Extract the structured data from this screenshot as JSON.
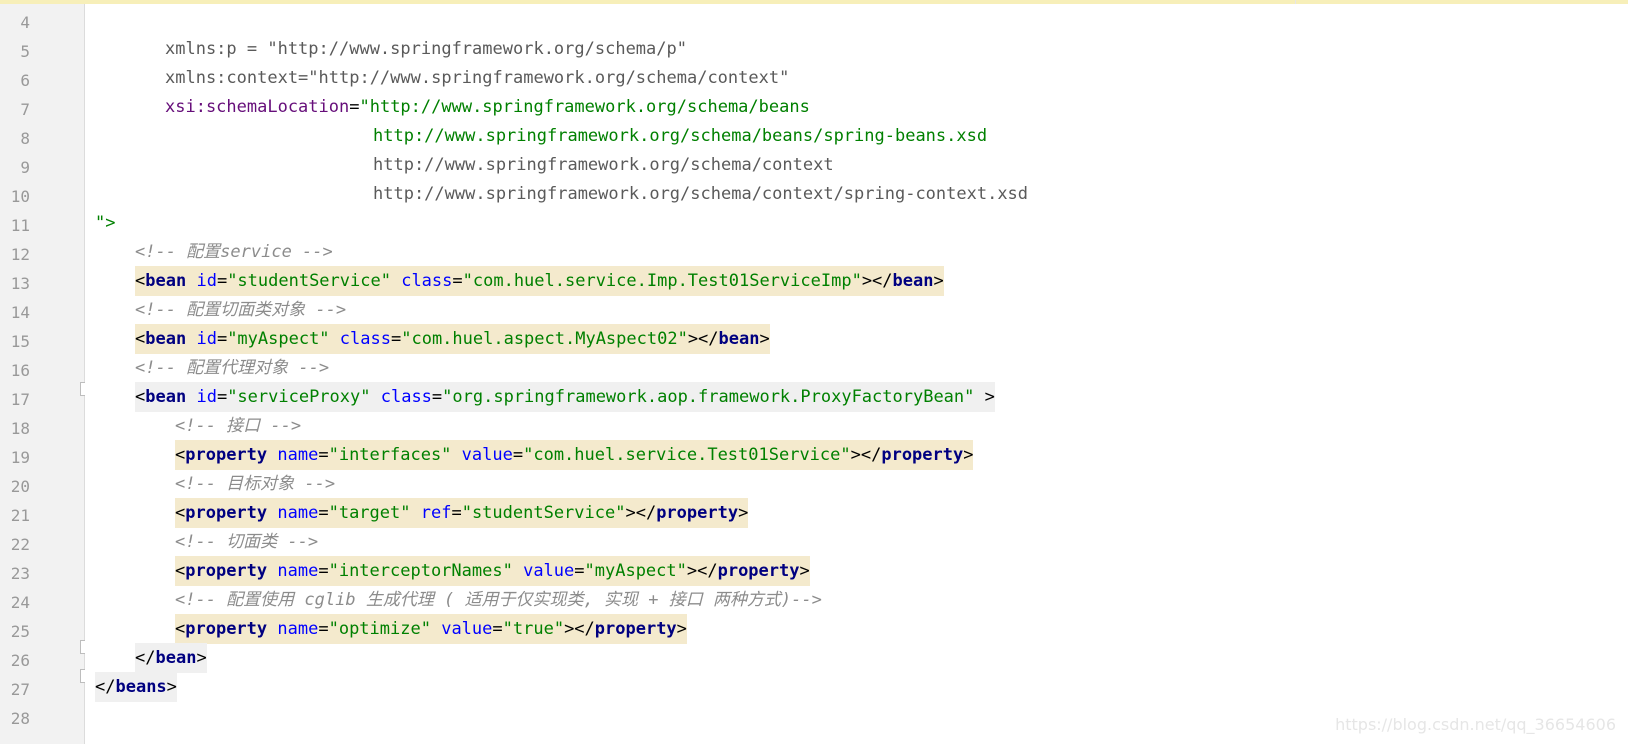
{
  "editor": {
    "lines": [
      {
        "no": "4"
      },
      {
        "no": "5"
      },
      {
        "no": "6"
      },
      {
        "no": "7"
      },
      {
        "no": "8"
      },
      {
        "no": "9"
      },
      {
        "no": "10"
      },
      {
        "no": "11"
      },
      {
        "no": "12"
      },
      {
        "no": "13"
      },
      {
        "no": "14"
      },
      {
        "no": "15"
      },
      {
        "no": "16"
      },
      {
        "no": "17"
      },
      {
        "no": "18"
      },
      {
        "no": "19"
      },
      {
        "no": "20"
      },
      {
        "no": "21"
      },
      {
        "no": "22"
      },
      {
        "no": "23"
      },
      {
        "no": "24"
      },
      {
        "no": "25"
      },
      {
        "no": "26"
      },
      {
        "no": "27"
      },
      {
        "no": "28"
      }
    ],
    "code": {
      "l4": "xmlns:p = \"http://www.springframework.org/schema/p\"",
      "l5": "xmlns:context=\"http://www.springframework.org/schema/context\"",
      "l6_attr": "xsi:schemaLocation",
      "l6_val": "\"http://www.springframework.org/schema/beans",
      "l7": "http://www.springframework.org/schema/beans/spring-beans.xsd",
      "l8": "http://www.springframework.org/schema/context",
      "l9": "http://www.springframework.org/schema/context/spring-context.xsd",
      "l10": "\">",
      "c11": "<!-- 配置service -->",
      "bean_tag": "bean",
      "id_attr": "id",
      "class_attr": "class",
      "l12_id": "\"studentService\"",
      "l12_class": "\"com.huel.service.Imp.Test01ServiceImp\"",
      "c13": "<!-- 配置切面类对象 -->",
      "l14_id": "\"myAspect\"",
      "l14_class": "\"com.huel.aspect.MyAspect02\"",
      "c15": "<!-- 配置代理对象 -->",
      "l16_id": "\"serviceProxy\"",
      "l16_class": "\"org.springframework.aop.framework.ProxyFactoryBean\"",
      "c17": "<!-- 接口 -->",
      "prop_tag": "property",
      "name_attr": "name",
      "value_attr": "value",
      "ref_attr": "ref",
      "l18_name": "\"interfaces\"",
      "l18_value": "\"com.huel.service.Test01Service\"",
      "c19": "<!-- 目标对象 -->",
      "l20_name": "\"target\"",
      "l20_ref": "\"studentService\"",
      "c21": "<!-- 切面类 -->",
      "l22_name": "\"interceptorNames\"",
      "l22_value": "\"myAspect\"",
      "c23": "<!-- 配置使用 cglib 生成代理 ( 适用于仅实现类, 实现 + 接口 两种方式)-->",
      "l24_name": "\"optimize\"",
      "l24_value": "\"true\"",
      "beans_tag": "beans"
    }
  },
  "watermark": "https://blog.csdn.net/qq_36654606",
  "colors": {
    "tag": "#000080",
    "attribute": "#0000ff",
    "value": "#008000",
    "comment": "#8c8c8c",
    "highlight": "#f4eacd",
    "gutter": "#f2f2f2"
  }
}
